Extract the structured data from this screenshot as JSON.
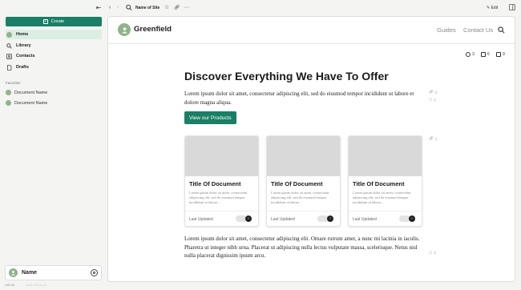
{
  "sidebar": {
    "create_label": "Create",
    "nav": [
      {
        "label": "Home",
        "icon": "home-avatar-icon",
        "active": true
      },
      {
        "label": "Library",
        "icon": "search-icon"
      },
      {
        "label": "Contacts",
        "icon": "contacts-icon"
      },
      {
        "label": "Drafts",
        "icon": "document-icon"
      }
    ],
    "favorites_label": "Favorites",
    "favorites": [
      {
        "label": "Document Name"
      },
      {
        "label": "Document Name"
      }
    ],
    "user_name": "Name",
    "version": "v15.20",
    "version_hint": "build 2024.4.4"
  },
  "topbar": {
    "site_name": "Name of Site",
    "edit_label": "Edit"
  },
  "site": {
    "logo_text": "Greenfield",
    "nav": [
      "Guides",
      "Contact Us"
    ],
    "stats": {
      "history": "3",
      "comments": "6",
      "subscribers": "9"
    },
    "hero_title": "Discover Everything We Have To Offer",
    "intro": "Lorem ipsum dolor sit amet, consectetur adipiscing elit, sed do eiusmod tempor incididunt ut labore et dolore magna aliqua.",
    "cta_label": "View our Products",
    "markers": {
      "m1": "2",
      "m2": "1",
      "m3": "1",
      "m4": "2"
    },
    "cards": [
      {
        "title": "Title Of Document",
        "desc": "Lorem ipsum dolor sit amet, consectetur adipiscing elit, sed do eiusmod tempor incididunt ut labore...",
        "updated": "Last Updated"
      },
      {
        "title": "Title Of Document",
        "desc": "Lorem ipsum dolor sit amet, consectetur adipiscing elit, sed do eiusmod tempor incididunt ut labore...",
        "updated": "Last Updated"
      },
      {
        "title": "Title Of Document",
        "desc": "Lorem ipsum dolor sit amet, consectetur adipiscing elit, sed do eiusmod tempor incididunt ut labore...",
        "updated": "Last Updated"
      }
    ],
    "outro": "Lorem ipsum dolor sit amet, consectetur adipiscing elit. Omare rutrum amet, a nunc mi lacinia in iaculis. Pharetra ut integer nibh urna. Placerat ut adipiscing nulla lectus vulputate massa, scelerisque. Netus nisl nulla placerat dignissim ipsum arcu."
  },
  "colors": {
    "accent": "#1a7f64",
    "active_bg": "#dbeee4",
    "avatar": "#8fb48a"
  }
}
